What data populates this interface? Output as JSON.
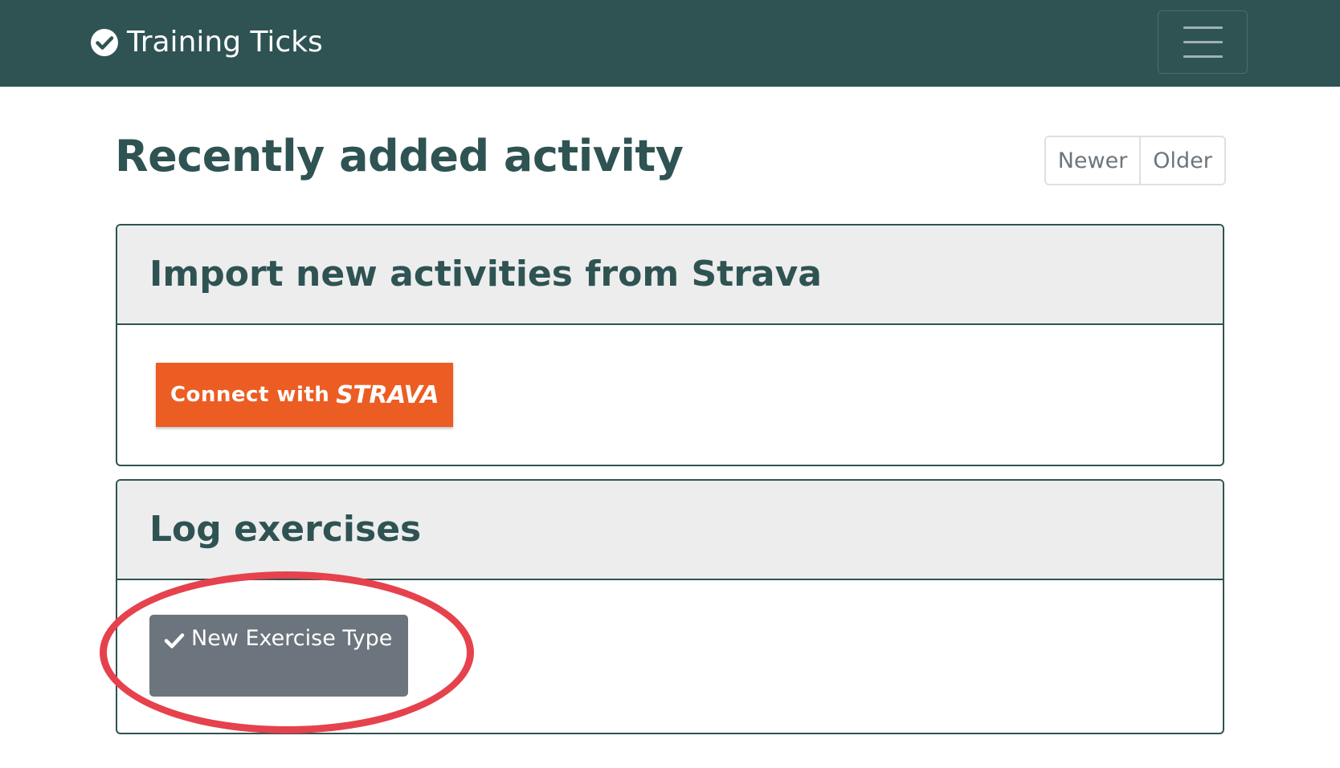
{
  "navbar": {
    "brand_icon": "check-circle-icon",
    "brand_text": "Training Ticks",
    "menu_icon": "hamburger-menu-icon",
    "background_color": "#2e5352"
  },
  "main": {
    "title": "Recently added activity",
    "pagination": {
      "newer_label": "Newer",
      "older_label": "Older"
    }
  },
  "strava_card": {
    "title": "Import new activities from Strava",
    "button": {
      "connect_text": "Connect with",
      "brand_text": "STRAVA",
      "color": "#ec5d24"
    }
  },
  "log_card": {
    "title": "Log exercises",
    "button": {
      "icon": "checkmark-icon",
      "label": "New Exercise Type",
      "color": "#6c757d"
    }
  },
  "annotation": {
    "highlight_color": "#e5424d"
  }
}
